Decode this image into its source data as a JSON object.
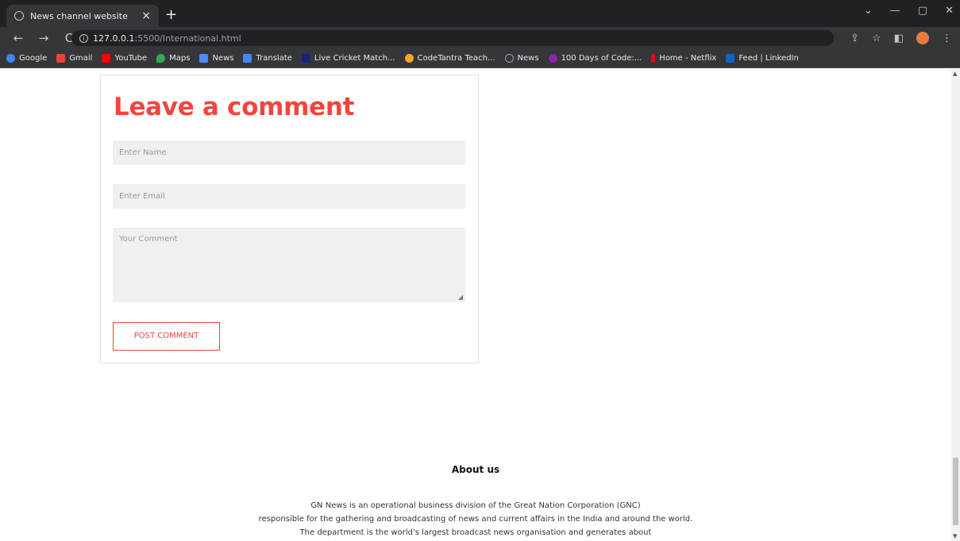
{
  "browser": {
    "tab_title": "News channel website",
    "tab_close": "×",
    "new_tab": "+",
    "url_host": "127.0.0.1",
    "url_rest": ":5500/International.html",
    "nav_back": "←",
    "nav_forward": "→",
    "nav_reload": "C",
    "window_controls": [
      "⌄",
      "—",
      "▢",
      "✕"
    ],
    "toolbar_right": [
      "⇪",
      "☆",
      "◧",
      "⋮"
    ],
    "bookmarks": [
      {
        "label": "Google",
        "color": "#4285f4"
      },
      {
        "label": "Gmail",
        "color": "#ea4335"
      },
      {
        "label": "YouTube",
        "color": "#ff0000"
      },
      {
        "label": "Maps",
        "color": "#34a853"
      },
      {
        "label": "News",
        "color": "#4c8bf5"
      },
      {
        "label": "Translate",
        "color": "#4285f4"
      },
      {
        "label": "Live Cricket Match...",
        "color": "#1a237e"
      },
      {
        "label": "CodeTantra Teach...",
        "color": "#f9a825"
      },
      {
        "label": "News",
        "color": "#9aa0a6"
      },
      {
        "label": "100 Days of Code:...",
        "color": "#8e24aa"
      },
      {
        "label": "Home - Netflix",
        "color": "#e50914"
      },
      {
        "label": "Feed | LinkedIn",
        "color": "#0a66c2"
      }
    ]
  },
  "comment_form": {
    "title": "Leave a comment",
    "name_placeholder": "Enter Name",
    "email_placeholder": "Enter Email",
    "comment_placeholder": "Your Comment",
    "submit_label": "POST COMMENT",
    "accent_color": "#f2453d"
  },
  "about": {
    "title": "About us",
    "lines": [
      "GN News is an operational business division of the Great Nation Corporation (GNC)",
      "responsible for the gathering and broadcasting of news and current affairs in the India and around the world.",
      "The department is the world's largest broadcast news organisation and generates about"
    ]
  }
}
